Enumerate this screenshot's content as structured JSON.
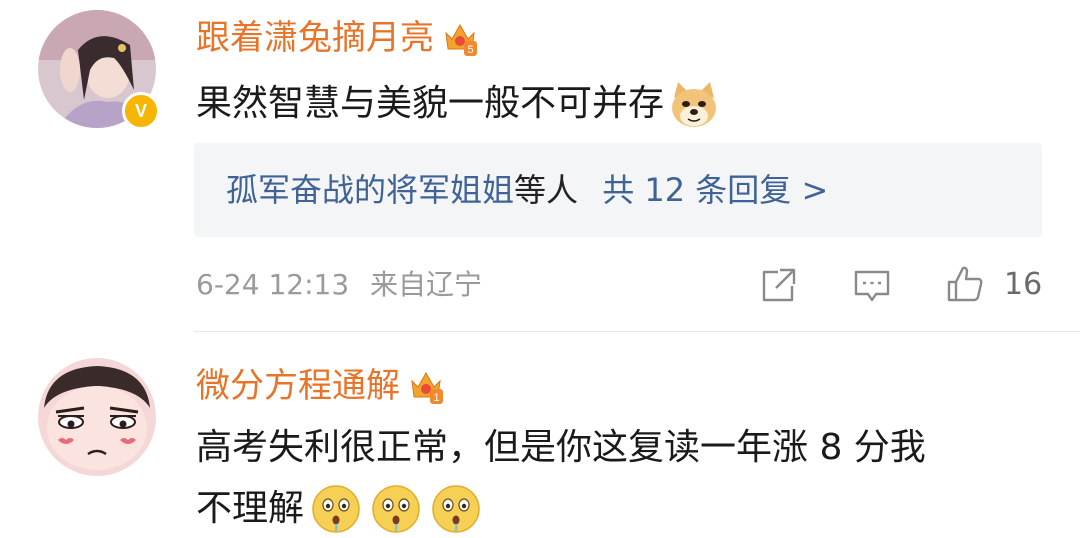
{
  "comments": [
    {
      "username": "跟着潇兔摘月亮",
      "crown_level": "5",
      "verified_badge": "V",
      "text": "果然智慧与美貌一般不可并存",
      "emojis": [
        "doge-emoji"
      ],
      "replies": {
        "names": "孤军奋战的将军姐姐",
        "others_suffix": "等人",
        "count_label": "共 12 条回复 >"
      },
      "time": "6-24 12:13",
      "location": "来自辽宁",
      "like_count": "16"
    },
    {
      "username": "微分方程通解",
      "crown_level": "1",
      "text_line1": "高考失利很正常，但是你这复读一年涨 8 分我",
      "text_line2": "不理解",
      "emojis": [
        "shocked-emoji",
        "shocked-emoji",
        "shocked-emoji"
      ]
    }
  ],
  "colors": {
    "username": "#e8742a",
    "reply_link": "#3f6396",
    "meta": "#9a9a9a",
    "badge": "#f7b500"
  }
}
